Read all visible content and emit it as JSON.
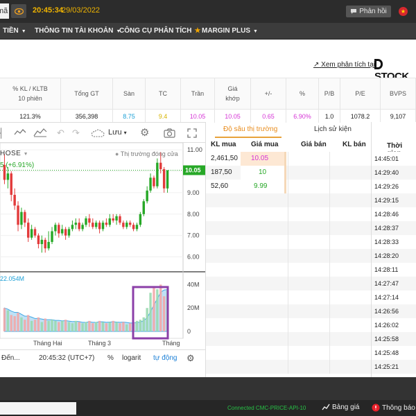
{
  "topbar": {
    "left_box_text": "mã",
    "time": "20:45:34",
    "date": "29/03/2022",
    "feedback_label": "Phản hồi"
  },
  "menu": {
    "items": [
      {
        "label": "TIỀN"
      },
      {
        "label": "THÔNG TIN TÀI KHOẢN"
      },
      {
        "label": "CÔNG CỤ PHÂN TÍCH"
      },
      {
        "label": "MARGIN PLUS"
      }
    ]
  },
  "header_link": {
    "text": "Xem phân tích tại",
    "brand": "STOCK"
  },
  "stats": {
    "headers": [
      {
        "line1": "% KL / KLTB",
        "line2": "10 phiên"
      },
      {
        "line1": "Tổng GT",
        "line2": ""
      },
      {
        "line1": "Sàn",
        "line2": ""
      },
      {
        "line1": "TC",
        "line2": ""
      },
      {
        "line1": "Trần",
        "line2": ""
      },
      {
        "line1": "Giá",
        "line2": "khớp"
      },
      {
        "line1": "+/-",
        "line2": ""
      },
      {
        "line1": "%",
        "line2": ""
      },
      {
        "line1": "P/B",
        "line2": ""
      },
      {
        "line1": "P/E",
        "line2": ""
      },
      {
        "line1": "BVPS",
        "line2": ""
      }
    ],
    "values": [
      "121.3%",
      "356,398",
      "8.75",
      "9.4",
      "10.05",
      "10.05",
      "0.65",
      "6.90%",
      "1.0",
      "1078.2",
      "9,107"
    ],
    "value_colors": [
      "#222222",
      "#222222",
      "#1a9fd6",
      "#d6b400",
      "#d633d6",
      "#d633d6",
      "#d633d6",
      "#d633d6",
      "#222222",
      "#222222",
      "#222222"
    ]
  },
  "chart_toolbar": {
    "save_label": "Lưu"
  },
  "chart": {
    "exchange": "HOSE",
    "change_text": "5 (+6.91%)",
    "market_status": "Thị trường đóng cửa",
    "volume_label": "22.054M",
    "current_price_label": "10.05",
    "price_ticks": [
      "11.00",
      "9.00",
      "8.00",
      "7.00",
      "6.00"
    ],
    "volume_ticks": [
      "40M",
      "20M",
      "0"
    ],
    "time_labels": [
      "Tháng Hai",
      "Tháng 3",
      "Tháng"
    ]
  },
  "chart_data": {
    "type": "candlestick",
    "ylim": [
      5.5,
      11.2
    ],
    "volume_ylim": [
      0,
      45
    ],
    "candles": [
      [
        10.3,
        9.6,
        10.8,
        9.4
      ],
      [
        9.6,
        9.9,
        10.2,
        9.2
      ],
      [
        9.9,
        8.9,
        10.0,
        8.6
      ],
      [
        8.9,
        8.4,
        9.2,
        8.2
      ],
      [
        8.4,
        7.5,
        8.6,
        7.2
      ],
      [
        7.5,
        8.1,
        8.3,
        7.3
      ],
      [
        8.1,
        7.6,
        8.2,
        7.4
      ],
      [
        7.6,
        6.9,
        7.8,
        6.7
      ],
      [
        6.9,
        7.3,
        7.5,
        6.8
      ],
      [
        7.3,
        7.0,
        7.4,
        6.9
      ],
      [
        7.0,
        6.6,
        7.1,
        6.4
      ],
      [
        6.6,
        6.8,
        7.0,
        6.2
      ],
      [
        6.8,
        6.4,
        6.9,
        6.2
      ],
      [
        6.4,
        6.7,
        7.2,
        6.3
      ],
      [
        6.7,
        7.2,
        7.4,
        6.6
      ],
      [
        7.2,
        7.5,
        7.6,
        7.0
      ],
      [
        7.5,
        7.1,
        7.6,
        6.9
      ],
      [
        7.1,
        7.3,
        7.5,
        7.0
      ],
      [
        7.3,
        7.0,
        7.4,
        6.8
      ],
      [
        7.0,
        7.3,
        7.4,
        6.9
      ],
      [
        7.3,
        7.5,
        7.7,
        7.2
      ],
      [
        7.5,
        7.6,
        7.8,
        7.3
      ],
      [
        7.6,
        7.3,
        7.8,
        7.2
      ],
      [
        7.3,
        7.5,
        7.6,
        7.2
      ],
      [
        7.5,
        7.8,
        7.9,
        7.4
      ],
      [
        7.8,
        7.6,
        8.0,
        7.4
      ],
      [
        7.6,
        7.4,
        7.8,
        7.3
      ],
      [
        7.4,
        7.6,
        7.7,
        7.3
      ],
      [
        7.6,
        7.3,
        7.7,
        7.1
      ],
      [
        7.3,
        7.6,
        7.7,
        7.2
      ],
      [
        7.6,
        7.5,
        7.8,
        7.4
      ],
      [
        7.5,
        7.8,
        8.0,
        7.4
      ],
      [
        7.8,
        7.7,
        8.0,
        7.6
      ],
      [
        7.7,
        7.9,
        8.0,
        7.5
      ],
      [
        7.9,
        7.6,
        8.0,
        7.5
      ],
      [
        7.6,
        7.4,
        7.7,
        7.3
      ],
      [
        7.4,
        7.6,
        7.7,
        7.3
      ],
      [
        7.6,
        7.5,
        7.7,
        7.4
      ],
      [
        7.5,
        7.3,
        7.6,
        7.2
      ],
      [
        7.3,
        7.5,
        7.6,
        7.2
      ],
      [
        7.5,
        8.0,
        8.1,
        7.4
      ],
      [
        8.0,
        8.6,
        8.7,
        7.9
      ],
      [
        8.6,
        9.1,
        9.3,
        8.5
      ],
      [
        9.1,
        9.7,
        9.9,
        9.0
      ],
      [
        9.7,
        9.3,
        9.8,
        9.2
      ],
      [
        9.3,
        10.4,
        10.6,
        9.2
      ],
      [
        10.4,
        10.1,
        10.9,
        9.9
      ],
      [
        10.1,
        9.2,
        10.2,
        9.0
      ],
      [
        9.2,
        10.05,
        10.05,
        9.0
      ]
    ],
    "volumes": [
      20,
      18,
      14,
      13,
      16,
      12,
      10,
      14,
      9,
      10,
      12,
      8,
      11,
      9,
      10,
      9,
      8,
      9,
      10,
      8,
      7,
      9,
      8,
      7,
      8,
      9,
      7,
      8,
      9,
      8,
      7,
      8,
      9,
      8,
      7,
      8,
      6,
      7,
      8,
      9,
      10,
      12,
      20,
      33,
      38,
      36,
      40,
      30,
      35
    ]
  },
  "bottom_tools": {
    "goto_label": "Đến...",
    "clock_label": "20:45:32 (UTC+7)",
    "percent_label": "%",
    "log_label": "logarit",
    "auto_label": "tự động"
  },
  "depth": {
    "tab_depth": "Độ sâu thị trường",
    "tab_history": "Lịch sử kiện",
    "col_kl_mua": "KL mua",
    "col_gia_mua": "Giá mua",
    "col_gia_ban": "Giá bán",
    "col_kl_ban": "KL bán",
    "col_time": "Thời gian",
    "bids": [
      {
        "kl": "2,461,50",
        "gia": "10.05"
      },
      {
        "kl": "187,50",
        "gia": "10"
      },
      {
        "kl": "52,60",
        "gia": "9.99"
      }
    ],
    "bid_colors": [
      "#d633d6",
      "#27a827",
      "#27a827"
    ],
    "times": [
      "14:45:01",
      "14:29:40",
      "14:29:26",
      "14:29:15",
      "14:28:46",
      "14:28:37",
      "14:28:33",
      "14:28:20",
      "14:28:11",
      "14:27:47",
      "14:27:14",
      "14:26:56",
      "14:26:02",
      "14:25:58",
      "14:25:48",
      "14:25:21"
    ]
  },
  "footer": {
    "connected_label": "Connected CMC-PRICE-API-10",
    "price_board_label": "Bảng giá",
    "notify_label": "Thông báo"
  }
}
